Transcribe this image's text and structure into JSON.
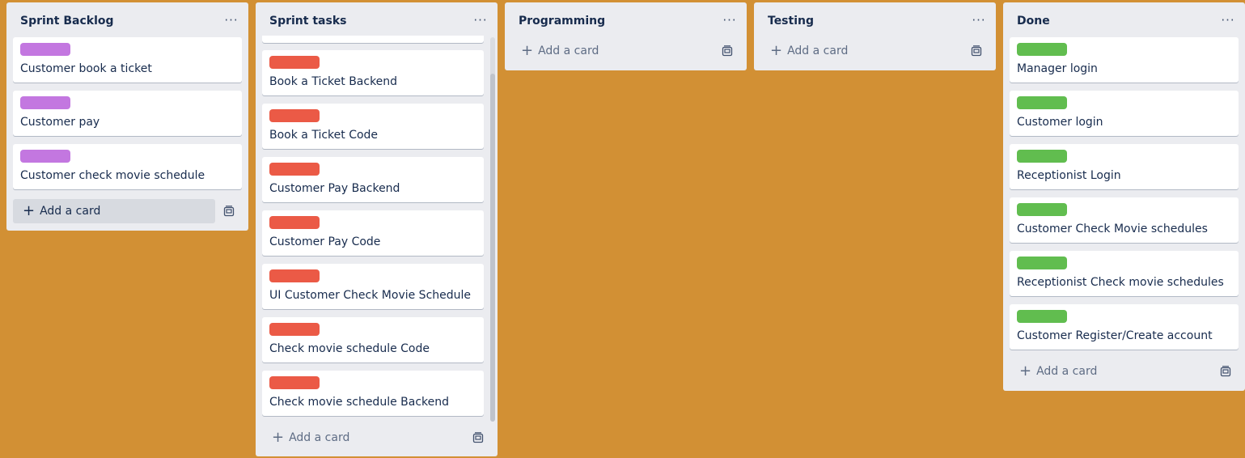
{
  "lists": [
    {
      "title": "Sprint Backlog",
      "menu": "···",
      "label_color": "#C377E0",
      "cards": [
        "Customer book a ticket",
        "Customer pay",
        "Customer check movie schedule"
      ],
      "add_card": "Add a card"
    },
    {
      "title": "Sprint tasks",
      "menu": "···",
      "label_color": "#EB5A46",
      "cards": [
        "Book a Ticket Backend",
        "Book a Ticket Code",
        "Customer Pay Backend",
        "Customer Pay Code",
        "UI Customer Check Movie Schedule",
        "Check movie schedule Code",
        "Check movie schedule Backend"
      ],
      "add_card": "Add a card"
    },
    {
      "title": "Programming",
      "menu": "···",
      "cards": [],
      "add_card": "Add a card"
    },
    {
      "title": "Testing",
      "menu": "···",
      "cards": [],
      "add_card": "Add a card"
    },
    {
      "title": "Done",
      "menu": "···",
      "label_color": "#61BD4F",
      "cards": [
        "Manager login",
        "Customer login",
        "Receptionist Login",
        "Customer Check Movie schedules",
        "Receptionist Check movie schedules",
        "Customer Register/Create account"
      ],
      "add_card": "Add a card"
    }
  ],
  "icons": {
    "menu": "more-horizontal-icon",
    "add": "plus-icon",
    "template": "card-template-icon"
  },
  "colors": {
    "board_background": "#D29034",
    "list_background": "#EBECF0",
    "text": "#172B4D"
  }
}
